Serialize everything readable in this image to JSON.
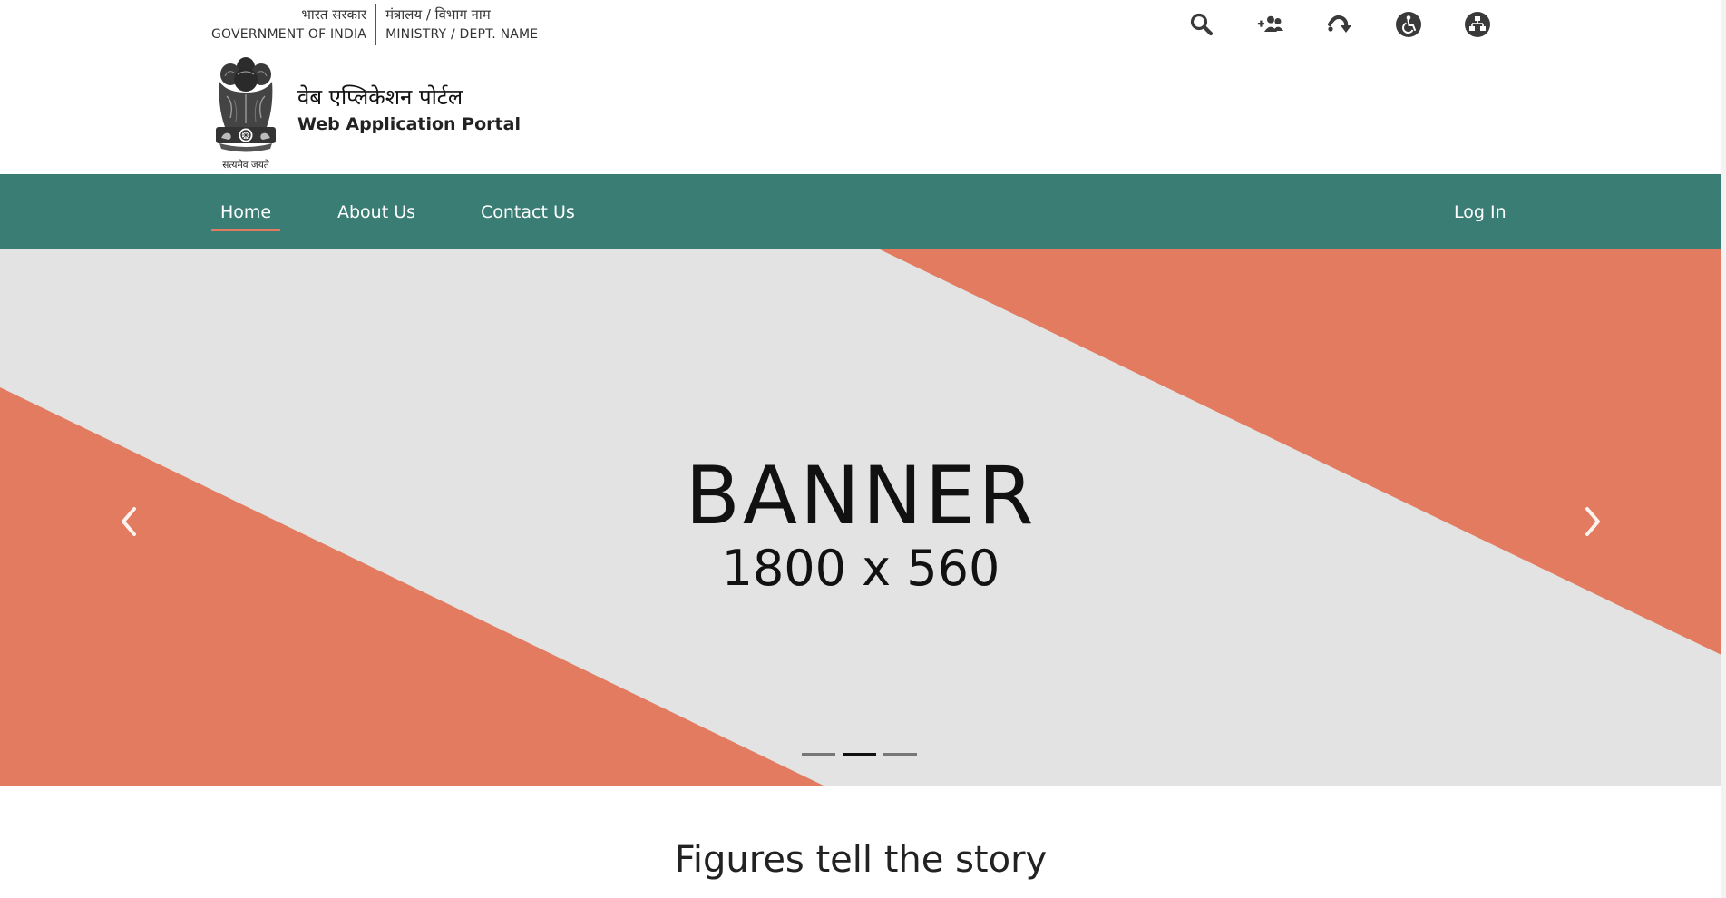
{
  "gov": {
    "hindi_gov": "भारत सरकार",
    "english_gov": "GOVERNMENT OF INDIA",
    "hindi_ministry": "मंत्रालय / विभाग नाम",
    "english_ministry": "MINISTRY / DEPT. NAME"
  },
  "utility_icons": [
    "search-icon",
    "add-user-icon",
    "skip-content-icon",
    "accessibility-icon",
    "sitemap-icon"
  ],
  "brand": {
    "emblem_motto": "सत्यमेव जयते",
    "title_hindi": "वेब एप्लिकेशन पोर्टल",
    "title_english": "Web Application Portal"
  },
  "nav": {
    "items": [
      {
        "label": "Home",
        "active": true
      },
      {
        "label": "About Us",
        "active": false
      },
      {
        "label": "Contact Us",
        "active": false
      }
    ],
    "login_label": "Log In"
  },
  "banner": {
    "title": "BANNER",
    "size_text": "1800 x 560",
    "slide_count": 3,
    "active_slide": 2
  },
  "figures": {
    "title": "Figures tell the story"
  },
  "colors": {
    "nav_bg": "#3a7d75",
    "accent": "#e27b60",
    "banner_bg": "#e3e3e3",
    "icon": "#3a3a3a"
  }
}
